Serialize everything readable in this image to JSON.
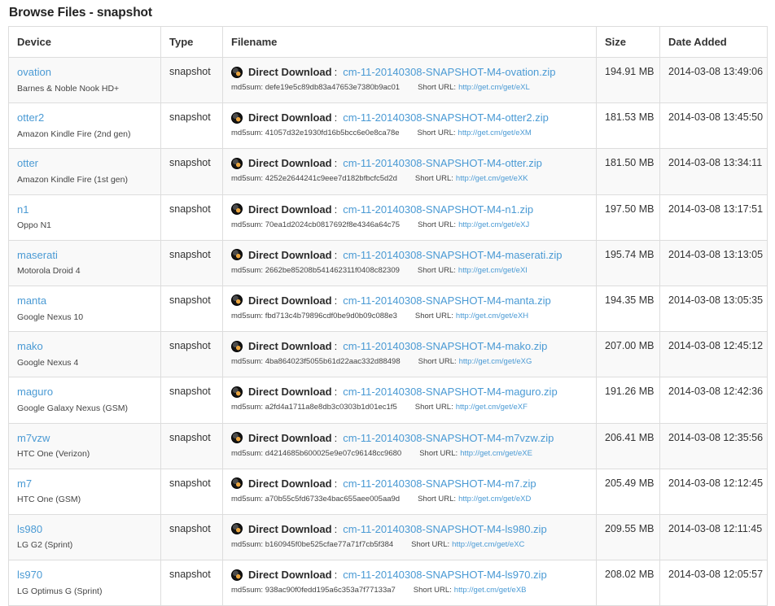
{
  "page": {
    "title": "Browse Files - snapshot"
  },
  "table": {
    "columns": [
      {
        "key": "device",
        "label": "Device"
      },
      {
        "key": "type",
        "label": "Type"
      },
      {
        "key": "filename",
        "label": "Filename"
      },
      {
        "key": "size",
        "label": "Size"
      },
      {
        "key": "date",
        "label": "Date Added"
      }
    ],
    "labels": {
      "direct_download": "Direct Download",
      "colon": ":",
      "md5_prefix": "md5sum:",
      "short_url_prefix": "Short URL:",
      "download_icon": "cyanogenmod-icon"
    },
    "rows": [
      {
        "device": "ovation",
        "device_desc": "Barnes & Noble Nook HD+",
        "type": "snapshot",
        "filename": "cm-11-20140308-SNAPSHOT-M4-ovation.zip",
        "md5sum": "defe19e5c89db83a47653e7380b9ac01",
        "short_url": "http://get.cm/get/eXL",
        "size": "194.91 MB",
        "date": "2014-03-08 13:49:06"
      },
      {
        "device": "otter2",
        "device_desc": "Amazon Kindle Fire (2nd gen)",
        "type": "snapshot",
        "filename": "cm-11-20140308-SNAPSHOT-M4-otter2.zip",
        "md5sum": "41057d32e1930fd16b5bcc6e0e8ca78e",
        "short_url": "http://get.cm/get/eXM",
        "size": "181.53 MB",
        "date": "2014-03-08 13:45:50"
      },
      {
        "device": "otter",
        "device_desc": "Amazon Kindle Fire (1st gen)",
        "type": "snapshot",
        "filename": "cm-11-20140308-SNAPSHOT-M4-otter.zip",
        "md5sum": "4252e2644241c9eee7d182bfbcfc5d2d",
        "short_url": "http://get.cm/get/eXK",
        "size": "181.50 MB",
        "date": "2014-03-08 13:34:11"
      },
      {
        "device": "n1",
        "device_desc": "Oppo N1",
        "type": "snapshot",
        "filename": "cm-11-20140308-SNAPSHOT-M4-n1.zip",
        "md5sum": "70ea1d2024cb0817692f8e4346a64c75",
        "short_url": "http://get.cm/get/eXJ",
        "size": "197.50 MB",
        "date": "2014-03-08 13:17:51"
      },
      {
        "device": "maserati",
        "device_desc": "Motorola Droid 4",
        "type": "snapshot",
        "filename": "cm-11-20140308-SNAPSHOT-M4-maserati.zip",
        "md5sum": "2662be85208b541462311f0408c82309",
        "short_url": "http://get.cm/get/eXI",
        "size": "195.74 MB",
        "date": "2014-03-08 13:13:05"
      },
      {
        "device": "manta",
        "device_desc": "Google Nexus 10",
        "type": "snapshot",
        "filename": "cm-11-20140308-SNAPSHOT-M4-manta.zip",
        "md5sum": "fbd713c4b79896cdf0be9d0b09c088e3",
        "short_url": "http://get.cm/get/eXH",
        "size": "194.35 MB",
        "date": "2014-03-08 13:05:35"
      },
      {
        "device": "mako",
        "device_desc": "Google Nexus 4",
        "type": "snapshot",
        "filename": "cm-11-20140308-SNAPSHOT-M4-mako.zip",
        "md5sum": "4ba864023f5055b61d22aac332d88498",
        "short_url": "http://get.cm/get/eXG",
        "size": "207.00 MB",
        "date": "2014-03-08 12:45:12"
      },
      {
        "device": "maguro",
        "device_desc": "Google Galaxy Nexus (GSM)",
        "type": "snapshot",
        "filename": "cm-11-20140308-SNAPSHOT-M4-maguro.zip",
        "md5sum": "a2fd4a1711a8e8db3c0303b1d01ec1f5",
        "short_url": "http://get.cm/get/eXF",
        "size": "191.26 MB",
        "date": "2014-03-08 12:42:36"
      },
      {
        "device": "m7vzw",
        "device_desc": "HTC One (Verizon)",
        "type": "snapshot",
        "filename": "cm-11-20140308-SNAPSHOT-M4-m7vzw.zip",
        "md5sum": "d4214685b600025e9e07c96148cc9680",
        "short_url": "http://get.cm/get/eXE",
        "size": "206.41 MB",
        "date": "2014-03-08 12:35:56"
      },
      {
        "device": "m7",
        "device_desc": "HTC One (GSM)",
        "type": "snapshot",
        "filename": "cm-11-20140308-SNAPSHOT-M4-m7.zip",
        "md5sum": "a70b55c5fd6733e4bac655aee005aa9d",
        "short_url": "http://get.cm/get/eXD",
        "size": "205.49 MB",
        "date": "2014-03-08 12:12:45"
      },
      {
        "device": "ls980",
        "device_desc": "LG G2 (Sprint)",
        "type": "snapshot",
        "filename": "cm-11-20140308-SNAPSHOT-M4-ls980.zip",
        "md5sum": "b160945f0be525cfae77a71f7cb5f384",
        "short_url": "http://get.cm/get/eXC",
        "size": "209.55 MB",
        "date": "2014-03-08 12:11:45"
      },
      {
        "device": "ls970",
        "device_desc": "LG Optimus G (Sprint)",
        "type": "snapshot",
        "filename": "cm-11-20140308-SNAPSHOT-M4-ls970.zip",
        "md5sum": "938ac90f0fedd195a6c353a7f77133a7",
        "short_url": "http://get.cm/get/eXB",
        "size": "208.02 MB",
        "date": "2014-03-08 12:05:57"
      }
    ]
  },
  "colors": {
    "link": "#4a9ad4",
    "border": "#dddddd",
    "stripe": "#f9f9f9",
    "text": "#333333"
  }
}
